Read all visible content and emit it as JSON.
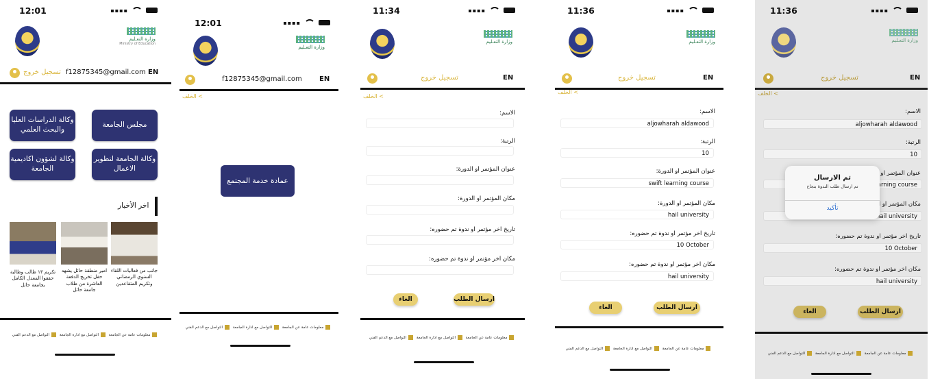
{
  "status": {
    "time_s1": "12:01",
    "time_s2": "12:01",
    "time_s3": "11:34",
    "time_s4": "11:36",
    "time_s5": "11:36"
  },
  "logo": {
    "ministry_line1": "وزارة التعـليم",
    "ministry_line2": "Ministry of Education"
  },
  "account": {
    "email": "f12875345@gmail.com",
    "logout": "تسجيل خروج",
    "lang": "EN"
  },
  "nav": {
    "back": "الخلف <"
  },
  "home": {
    "buttons": [
      "وكالة الدراسات العليا والبحث العلمي",
      "مجلس الجامعة",
      "وكالة لشؤون اكاديمية الجامعة",
      "وكالة الجامعة لتطوير الاعمال"
    ],
    "news_title": "اخر الأخبار",
    "news": [
      "تكريم ١٣ طالب وطالبة حققوا المعدل الكامل بجامعة حائل",
      "امير منطقة حائل يشهد حفل تخريج الدفعة العاشرة من طلاب جامعة حائل",
      "جانب من فعاليات اللقاء السنوي الرمضاني وتكريم المتقاعدين"
    ]
  },
  "service": {
    "button": "عمادة خدمة المجتمع"
  },
  "form": {
    "labels": [
      "الاسم:",
      "الرتبة:",
      "عنوان المؤتمر او الدورة:",
      "مكان المؤتمر او الدورة:",
      "تاريخ اخر مؤتمر او ندوة تم حضوره:",
      "مكان اخر مؤتمر او ندوة تم حضوره:"
    ],
    "values": [
      "aljowharah aldawood",
      "10",
      "swift learning course",
      "hail university",
      "10 October",
      "hail university"
    ],
    "submit": "ارسال الطلب",
    "cancel": "الغاء"
  },
  "alert": {
    "title": "تم الارسال",
    "message": "تم ارسال طلب الندوة بنجاح",
    "confirm": "تأكيد"
  },
  "footer": {
    "items": [
      "معلومات عامة عن الجامعة",
      "التواصل مع ادارة الجامعة",
      "التواصل مع الدعم الفني"
    ]
  }
}
